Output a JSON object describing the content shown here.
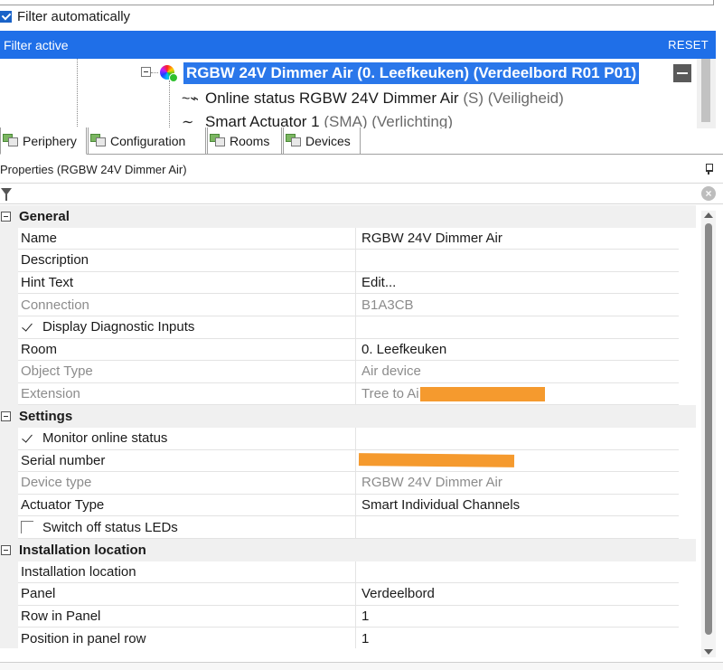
{
  "filter": {
    "auto_label": "Filter automatically",
    "auto_checked": true,
    "active_label": "Filter active",
    "reset_label": "RESET"
  },
  "tree": {
    "selected_label": "RGBW 24V Dimmer Air (0. Leefkeuken) (Verdeelbord R01 P01)",
    "children": [
      {
        "name": "Online status RGBW 24V Dimmer Air",
        "suffix": "(S) (Veiligheid)",
        "icon": "pulse-icon"
      },
      {
        "name": "Smart Actuator 1",
        "suffix": "(SMA) (Verlichting)",
        "icon": "wave-icon"
      }
    ]
  },
  "tabs": [
    {
      "label": "Periphery",
      "active": true
    },
    {
      "label": "Configuration",
      "active": false
    },
    {
      "label": "Rooms",
      "active": false
    },
    {
      "label": "Devices",
      "active": false
    }
  ],
  "properties": {
    "title": "Properties (RGBW 24V Dimmer Air)",
    "categories": {
      "general": "General",
      "settings": "Settings",
      "installation": "Installation location"
    },
    "rows": {
      "name": {
        "name": "Name",
        "value": "RGBW 24V Dimmer Air"
      },
      "description": {
        "name": "Description",
        "value": ""
      },
      "hint_text": {
        "name": "Hint Text",
        "value": "Edit..."
      },
      "connection": {
        "name": "Connection",
        "value": "B1A3CB"
      },
      "display_diag": {
        "name": "Display Diagnostic Inputs",
        "checked": true
      },
      "room": {
        "name": "Room",
        "value": "0. Leefkeuken"
      },
      "object_type": {
        "name": "Object Type",
        "value": "Air device"
      },
      "extension": {
        "name": "Extension",
        "value": "Tree to Ai"
      },
      "monitor_online": {
        "name": "Monitor online status",
        "checked": true
      },
      "serial_number": {
        "name": "Serial number",
        "value": ""
      },
      "device_type": {
        "name": "Device type",
        "value": "RGBW 24V Dimmer Air"
      },
      "actuator_type": {
        "name": "Actuator Type",
        "value": "Smart Individual Channels"
      },
      "switch_off_leds": {
        "name": "Switch off status LEDs",
        "checked": false
      },
      "installation_location": {
        "name": "Installation location",
        "value": ""
      },
      "panel": {
        "name": "Panel",
        "value": "Verdeelbord"
      },
      "row_in_panel": {
        "name": "Row in Panel",
        "value": "1"
      },
      "position_in_panel_row": {
        "name": "Position in panel row",
        "value": "1"
      }
    }
  },
  "colors": {
    "filter_bar": "#1f6fe8",
    "selection": "#2a77ea",
    "redaction": "#f59a2e"
  }
}
